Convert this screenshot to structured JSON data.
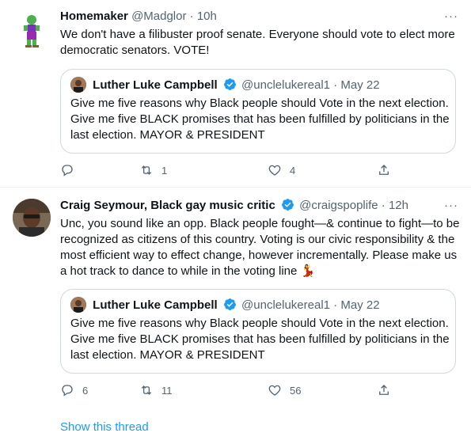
{
  "tweets": [
    {
      "name": "Homemaker",
      "handle": "@Madglor",
      "separator": "·",
      "time": "10h",
      "more": "···",
      "text": "We don't have a filibuster proof senate. Everyone should vote to elect more democratic senators. VOTE!",
      "quote": {
        "name": "Luther Luke Campbell",
        "handle": "@unclelukereal1",
        "separator": "·",
        "date": "May 22",
        "text": "Give me five reasons why Black people should Vote in the next election. Give me five BLACK promises that has been fulfilled by politicians in the last election. MAYOR & PRESIDENT"
      },
      "replies": "",
      "retweets": "1",
      "likes": "4"
    },
    {
      "name": "Craig Seymour, Black gay music critic",
      "handle": "@craigspoplife",
      "separator": "·",
      "time": "12h",
      "more": "···",
      "text": "Unc, you sound like an opp. Black people fought—& continue to fight—to be recognized as citizens of this country. Voting is our civic responsibility & the most efficient way to effect change, however incrementally. Please make us a hot track to dance to while in the voting line 💃",
      "quote": {
        "name": "Luther Luke Campbell",
        "handle": "@unclelukereal1",
        "separator": "·",
        "date": "May 22",
        "text": "Give me five reasons why Black people should Vote in the next election. Give me five BLACK promises that has been fulfilled by politicians in the last election. MAYOR & PRESIDENT"
      },
      "replies": "6",
      "retweets": "11",
      "likes": "56"
    }
  ],
  "show_thread": "Show this thread",
  "colors": {
    "accent": "#1d9bf0",
    "muted": "#536471",
    "border": "#cfd9de"
  }
}
